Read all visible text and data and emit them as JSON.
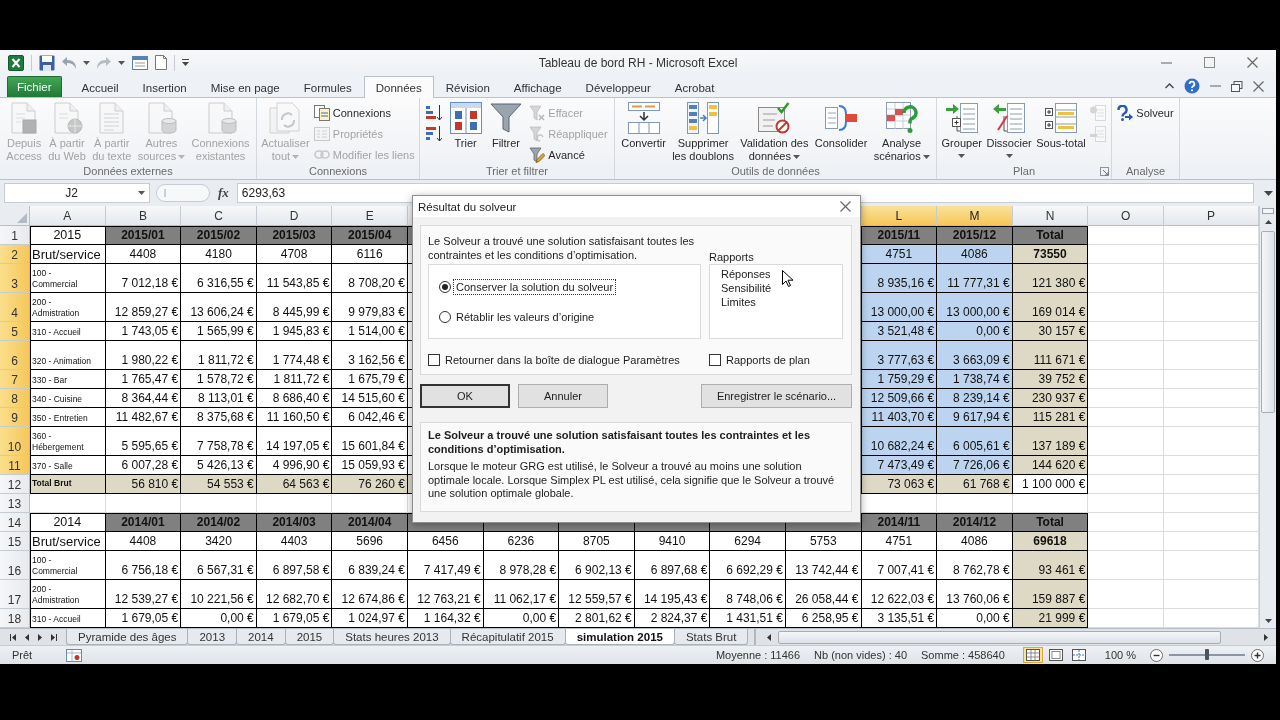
{
  "window": {
    "title": "Tableau de bord RH - Microsoft Excel"
  },
  "ribbon_tabs": [
    {
      "label": "Fichier",
      "kind": "file",
      "selected": false
    },
    {
      "label": "Accueil",
      "kind": "tab",
      "selected": false
    },
    {
      "label": "Insertion",
      "kind": "tab",
      "selected": false
    },
    {
      "label": "Mise en page",
      "kind": "tab",
      "selected": false
    },
    {
      "label": "Formules",
      "kind": "tab",
      "selected": false
    },
    {
      "label": "Données",
      "kind": "tab",
      "selected": true
    },
    {
      "label": "Révision",
      "kind": "tab",
      "selected": false
    },
    {
      "label": "Affichage",
      "kind": "tab",
      "selected": false
    },
    {
      "label": "Développeur",
      "kind": "tab",
      "selected": false
    },
    {
      "label": "Acrobat",
      "kind": "tab",
      "selected": false
    }
  ],
  "ribbon": {
    "groups": [
      {
        "label": "Données externes",
        "buttons": [
          {
            "kind": "large",
            "label": "Depuis\nAccess",
            "disabled": true
          },
          {
            "kind": "large",
            "label": "À partir\ndu Web",
            "disabled": true
          },
          {
            "kind": "large",
            "label": "À partir\ndu texte",
            "disabled": true
          },
          {
            "kind": "large",
            "label": "Autres\nsources",
            "disabled": true,
            "dropdown": true
          },
          {
            "kind": "large",
            "label": "Connexions\nexistantes",
            "disabled": true
          }
        ]
      },
      {
        "label": "Connexions",
        "buttons": [
          {
            "kind": "large",
            "label": "Actualiser\ntout",
            "disabled": true,
            "dropdown": true
          },
          {
            "kind": "small",
            "label": "Connexions",
            "disabled": false
          },
          {
            "kind": "small",
            "label": "Propriétés",
            "disabled": true
          },
          {
            "kind": "small",
            "label": "Modifier les liens",
            "disabled": true
          }
        ]
      },
      {
        "label": "Trier et filtrer",
        "buttons": [
          {
            "kind": "icon",
            "disabled": false
          },
          {
            "kind": "icon",
            "disabled": false
          },
          {
            "kind": "large",
            "label": "Trier",
            "disabled": false
          },
          {
            "kind": "large",
            "label": "Filtrer",
            "disabled": false
          },
          {
            "kind": "small",
            "label": "Effacer",
            "disabled": true
          },
          {
            "kind": "small",
            "label": "Réappliquer",
            "disabled": true
          },
          {
            "kind": "small",
            "label": "Avancé",
            "disabled": false
          }
        ]
      },
      {
        "label": "Outils de données",
        "buttons": [
          {
            "kind": "large",
            "label": "Convertir",
            "disabled": false
          },
          {
            "kind": "large",
            "label": "Supprimer\nles doublons",
            "disabled": false
          },
          {
            "kind": "large",
            "label": "Validation des\ndonnées",
            "disabled": false,
            "dropdown": true
          },
          {
            "kind": "large",
            "label": "Consolider",
            "disabled": false
          },
          {
            "kind": "large",
            "label": "Analyse\nscénarios",
            "disabled": false,
            "dropdown": true
          }
        ]
      },
      {
        "label": "Plan",
        "launcher": true,
        "buttons": [
          {
            "kind": "large",
            "label": "Grouper",
            "disabled": false,
            "dropdown": true
          },
          {
            "kind": "large",
            "label": "Dissocier",
            "disabled": false,
            "dropdown": true
          },
          {
            "kind": "large",
            "label": "Sous-total",
            "disabled": false
          },
          {
            "kind": "icon",
            "disabled": true
          },
          {
            "kind": "icon",
            "disabled": true
          }
        ]
      },
      {
        "label": "Analyse",
        "buttons": [
          {
            "kind": "small",
            "label": "Solveur",
            "disabled": false
          }
        ]
      }
    ]
  },
  "formula_bar": {
    "name_box": "J2",
    "function_button": "fx",
    "value": "6293,63"
  },
  "sheet": {
    "columns": [
      {
        "label": "A",
        "kind": "label",
        "selected": false
      },
      {
        "label": "B",
        "kind": "month",
        "selected": false
      },
      {
        "label": "C",
        "kind": "month",
        "selected": false
      },
      {
        "label": "D",
        "kind": "month",
        "selected": false
      },
      {
        "label": "E",
        "kind": "month",
        "selected": false
      },
      null,
      null,
      null,
      null,
      null,
      null,
      {
        "label": "L",
        "kind": "month",
        "selected": true
      },
      {
        "label": "M",
        "kind": "month",
        "selected": true
      },
      {
        "label": "N",
        "kind": "total",
        "selected": false
      },
      {
        "label": "O",
        "kind": "blank",
        "selected": false
      },
      {
        "label": "P",
        "kind": "blank",
        "selected": false
      }
    ],
    "rows": [
      {
        "number": "1",
        "kind": "year-header",
        "selected": false,
        "cells": [
          "2015",
          "2015/01",
          "2015/02",
          "2015/03",
          "2015/04",
          null,
          null,
          null,
          null,
          null,
          null,
          "2015/11",
          "2015/12",
          "Total"
        ]
      },
      {
        "number": "2",
        "kind": "count",
        "selected": true,
        "cells": [
          "Brut/service",
          "4408",
          "4180",
          "4708",
          "6116",
          null,
          null,
          null,
          null,
          null,
          null,
          "4751",
          "4086",
          "73550"
        ]
      },
      {
        "number": "3",
        "kind": "service",
        "selected": true,
        "cells": [
          "100 -\nCommercial",
          "7 012,18 €",
          "6 316,55 €",
          "11 543,85 €",
          "8 708,20 €",
          null,
          null,
          null,
          null,
          null,
          null,
          "8 935,16 €",
          "11 777,31 €",
          "121 380 €"
        ]
      },
      {
        "number": "4",
        "kind": "service",
        "selected": true,
        "cells": [
          "200 -\nAdmistration",
          "12 859,27 €",
          "13 606,24 €",
          "8 445,99 €",
          "9 979,83 €",
          null,
          null,
          null,
          null,
          null,
          null,
          "13 000,00 €",
          "13 000,00 €",
          "169 014 €"
        ]
      },
      {
        "number": "5",
        "kind": "service",
        "selected": true,
        "cells": [
          "310 - Accueil",
          "1 743,05 €",
          "1 565,99 €",
          "1 945,83 €",
          "1 514,00 €",
          null,
          null,
          null,
          null,
          null,
          null,
          "3 521,48 €",
          "0,00 €",
          "30 157 €"
        ]
      },
      {
        "number": "6",
        "kind": "service",
        "selected": true,
        "cells": [
          "320 - Animation",
          "1 980,22 €",
          "1 811,72 €",
          "1 774,48 €",
          "3 162,56 €",
          null,
          null,
          null,
          null,
          null,
          null,
          "3 777,63 €",
          "3 663,09 €",
          "111 671 €"
        ]
      },
      {
        "number": "7",
        "kind": "service",
        "selected": true,
        "cells": [
          "330 - Bar",
          "1 765,47 €",
          "1 578,72 €",
          "1 811,72 €",
          "1 675,79 €",
          null,
          null,
          null,
          null,
          null,
          null,
          "1 759,29 €",
          "1 738,74 €",
          "39 752 €"
        ]
      },
      {
        "number": "8",
        "kind": "service",
        "selected": true,
        "cells": [
          "340 - Cuisine",
          "8 364,44 €",
          "8 113,01 €",
          "8 686,40 €",
          "14 515,60 €",
          null,
          null,
          null,
          null,
          null,
          null,
          "12 509,66 €",
          "8 239,14 €",
          "230 937 €"
        ]
      },
      {
        "number": "9",
        "kind": "service",
        "selected": true,
        "cells": [
          "350 - Entretien",
          "11 482,67 €",
          "8 375,68 €",
          "11 160,50 €",
          "6 042,46 €",
          null,
          null,
          null,
          null,
          null,
          null,
          "11 403,70 €",
          "9 617,94 €",
          "115 281 €"
        ]
      },
      {
        "number": "10",
        "kind": "service",
        "selected": true,
        "cells": [
          "360 -\nHébergement",
          "5 595,65 €",
          "7 758,78 €",
          "14 197,05 €",
          "15 601,84 €",
          null,
          null,
          null,
          null,
          null,
          null,
          "10 682,24 €",
          "6 005,61 €",
          "137 189 €"
        ]
      },
      {
        "number": "11",
        "kind": "service",
        "selected": true,
        "cells": [
          "370 - Salle",
          "6 007,28 €",
          "5 426,13 €",
          "4 996,90 €",
          "15 059,93 €",
          null,
          null,
          null,
          null,
          null,
          null,
          "7 473,49 €",
          "7 726,06 €",
          "144 620 €"
        ]
      },
      {
        "number": "12",
        "kind": "total",
        "selected": false,
        "cells": [
          "Total Brut",
          "56 810 €",
          "54 553 €",
          "64 563 €",
          "76 260 €",
          null,
          null,
          null,
          null,
          null,
          null,
          "73 063 €",
          "61 768 €",
          "1 100 000 €"
        ]
      },
      {
        "number": "13",
        "kind": "blank",
        "selected": false
      },
      {
        "number": "14",
        "kind": "year-header",
        "selected": false,
        "cells": [
          "2014",
          "2014/01",
          "2014/02",
          "2014/03",
          "2014/04",
          null,
          null,
          null,
          null,
          null,
          null,
          "2014/11",
          "2014/12",
          "Total"
        ]
      },
      {
        "number": "15",
        "kind": "count",
        "selected": false,
        "cells": [
          "Brut/service",
          "4408",
          "3420",
          "4403",
          "5696",
          "6456",
          "6236",
          "8705",
          "9410",
          "6294",
          "5753",
          "4751",
          "4086",
          "69618"
        ]
      },
      {
        "number": "16",
        "kind": "service",
        "selected": false,
        "cells": [
          "100 -\nCommercial",
          "6 756,18 €",
          "6 567,31 €",
          "6 897,58 €",
          "6 839,24 €",
          "7 417,49 €",
          "8 978,28 €",
          "6 902,13 €",
          "6 897,68 €",
          "6 692,29 €",
          "13 742,44 €",
          "7 007,41 €",
          "8 762,78 €",
          "93 461 €"
        ]
      },
      {
        "number": "17",
        "kind": "service",
        "selected": false,
        "cells": [
          "200 -\nAdmistration",
          "12 539,27 €",
          "10 221,56 €",
          "12 682,70 €",
          "12 674,86 €",
          "12 763,21 €",
          "11 062,17 €",
          "12 559,57 €",
          "14 195,43 €",
          "8 748,06 €",
          "26 058,44 €",
          "12 622,03 €",
          "13 760,06 €",
          "159 887 €"
        ]
      },
      {
        "number": "18",
        "kind": "service",
        "selected": false,
        "cells": [
          "310 - Accueil",
          "1 679,05 €",
          "0,00 €",
          "1 679,05 €",
          "1 024,97 €",
          "1 164,32 €",
          "0,00 €",
          "2 801,62 €",
          "2 824,37 €",
          "1 431,51 €",
          "6 258,95 €",
          "3 135,51 €",
          "0,00 €",
          "21 999 €"
        ]
      }
    ]
  },
  "dialog": {
    "title": "Résultat du solveur",
    "message": "Le Solveur a trouvé une solution satisfaisant toutes les contraintes et les conditions d’optimisation.",
    "options": [
      {
        "label": "Conserver la solution du solveur",
        "selected": true
      },
      {
        "label": "Rétablir les valeurs d’origine",
        "selected": false
      }
    ],
    "reports_label": "Rapports",
    "reports": [
      {
        "label": "Réponses",
        "selected": false
      },
      {
        "label": "Sensibilité",
        "selected": false
      },
      {
        "label": "Limites",
        "selected": false
      }
    ],
    "checkboxes": [
      {
        "label": "Retourner dans la boîte de dialogue Paramètres",
        "checked": false
      },
      {
        "label": "Rapports de plan",
        "checked": false
      }
    ],
    "buttons": [
      {
        "label": "OK",
        "default": true
      },
      {
        "label": "Annuler",
        "default": false
      },
      {
        "label": "Enregistrer le scénario...",
        "default": false
      }
    ],
    "summary": "Le Solveur a trouvé une solution satisfaisant toutes les contraintes et les conditions d’optimisation.",
    "details": "Lorsque le moteur GRG est utilisé, le Solveur a trouvé au moins une solution optimale locale. Lorsque Simplex PL est utilisé, cela signifie que le Solveur a trouvé une solution optimale globale."
  },
  "sheet_tabs": [
    {
      "label": "Pyramide des âges",
      "selected": false
    },
    {
      "label": "2013",
      "selected": false
    },
    {
      "label": "2014",
      "selected": false
    },
    {
      "label": "2015",
      "selected": false
    },
    {
      "label": "Stats heures 2013",
      "selected": false
    },
    {
      "label": "Récapitulatif 2015",
      "selected": false
    },
    {
      "label": "simulation 2015",
      "selected": true
    },
    {
      "label": "Stats Brut",
      "selected": false
    }
  ],
  "status_bar": {
    "mode": "Prêt",
    "average": "Moyenne : 11466",
    "count": "Nb (non vides) : 40",
    "sum": "Somme : 458640",
    "views": [
      {
        "selected": true
      },
      {
        "selected": false
      },
      {
        "selected": false
      }
    ],
    "zoom": "100 %",
    "zoom_slider": {
      "level": 0.5
    }
  }
}
